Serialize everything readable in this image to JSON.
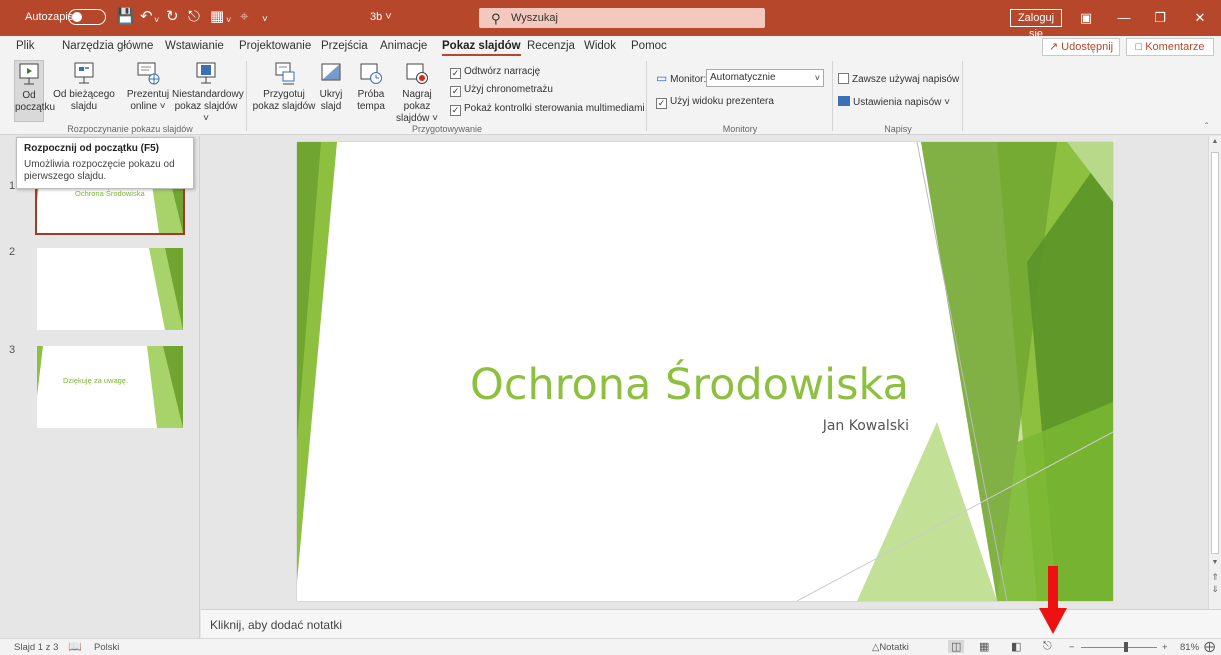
{
  "titlebar": {
    "autosave_label": "Autozapis",
    "document_name": "3b",
    "search_placeholder": "Wyszukaj",
    "signin_label": "Zaloguj się"
  },
  "menu": {
    "tabs": [
      "Plik",
      "Narzędzia główne",
      "Wstawianie",
      "Projektowanie",
      "Przejścia",
      "Animacje",
      "Pokaz slajdów",
      "Recenzja",
      "Widok",
      "Pomoc"
    ],
    "active_tab": "Pokaz slajdów",
    "share_label": "Udostępnij",
    "comments_label": "Komentarze"
  },
  "ribbon": {
    "start_group": {
      "label": "Rozpoczynanie pokazu slajdów",
      "from_beginning": [
        "Od",
        "początku"
      ],
      "from_current": [
        "Od bieżącego",
        "slajdu"
      ],
      "present_online": [
        "Prezentuj",
        "online ˅"
      ],
      "custom_show": [
        "Niestandardowy",
        "pokaz slajdów ˅"
      ]
    },
    "setup_group": {
      "label": "Przygotowywanie",
      "setup_show": [
        "Przygotuj",
        "pokaz slajdów"
      ],
      "hide_slide": [
        "Ukryj",
        "slajd"
      ],
      "rehearse": [
        "Próba",
        "tempa"
      ],
      "record": [
        "Nagraj pokaz",
        "slajdów ˅"
      ],
      "play_narration": "Odtwórz narrację",
      "use_timings": "Użyj chronometrażu",
      "show_media_controls": "Pokaż kontrolki sterowania multimediami"
    },
    "monitors_group": {
      "label": "Monitory",
      "monitor_label": "Monitor:",
      "monitor_value": "Automatycznie",
      "presenter_view": "Użyj widoku prezentera"
    },
    "captions_group": {
      "label": "Napisy",
      "always_captions": "Zawsze używaj napisów",
      "caption_settings": "Ustawienia napisów ˅"
    }
  },
  "tooltip": {
    "title": "Rozpocznij od początku (F5)",
    "body": "Umożliwia rozpoczęcie pokazu od pierwszego slajdu."
  },
  "thumbnails": [
    {
      "number": "1",
      "text": "Ochrona Środowiska"
    },
    {
      "number": "2",
      "text": ""
    },
    {
      "number": "3",
      "text": "Dziękuję za uwagę."
    }
  ],
  "slide": {
    "title": "Ochrona Środowiska",
    "subtitle": "Jan Kowalski"
  },
  "notes_placeholder": "Kliknij, aby dodać notatki",
  "statusbar": {
    "slide_counter": "Slajd 1 z 3",
    "language": "Polski",
    "notes_label": "Notatki",
    "zoom_minus": "−",
    "zoom_plus": "+",
    "zoom_percent": "81%"
  },
  "colors": {
    "accent": "#b7472a",
    "slide_green": "#8dc03f",
    "annotation_red": "#ee1111"
  }
}
